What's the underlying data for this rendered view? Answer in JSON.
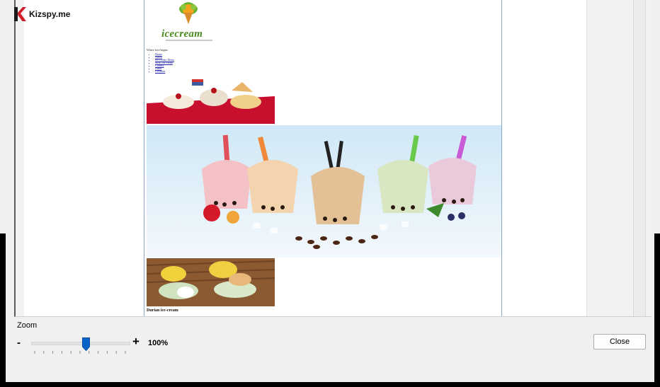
{
  "brand": {
    "name": "Kizspy.me",
    "icon": "k-logo-icon",
    "accent": "#d21f2b"
  },
  "preview": {
    "logo_text": "icecream",
    "tagline": "Where love begins",
    "nav": [
      "Home",
      "About",
      "Ice Cream Menu",
      "Milk Tea Menu",
      "Contact",
      "Order",
      "Location"
    ],
    "caption": "Durian ice-cream"
  },
  "zoom": {
    "label": "Zoom",
    "minus": "-",
    "plus": "+",
    "value_text": "100%",
    "level_fraction": 0.5,
    "accent": "#0a64c8"
  },
  "buttons": {
    "close": "Close"
  }
}
